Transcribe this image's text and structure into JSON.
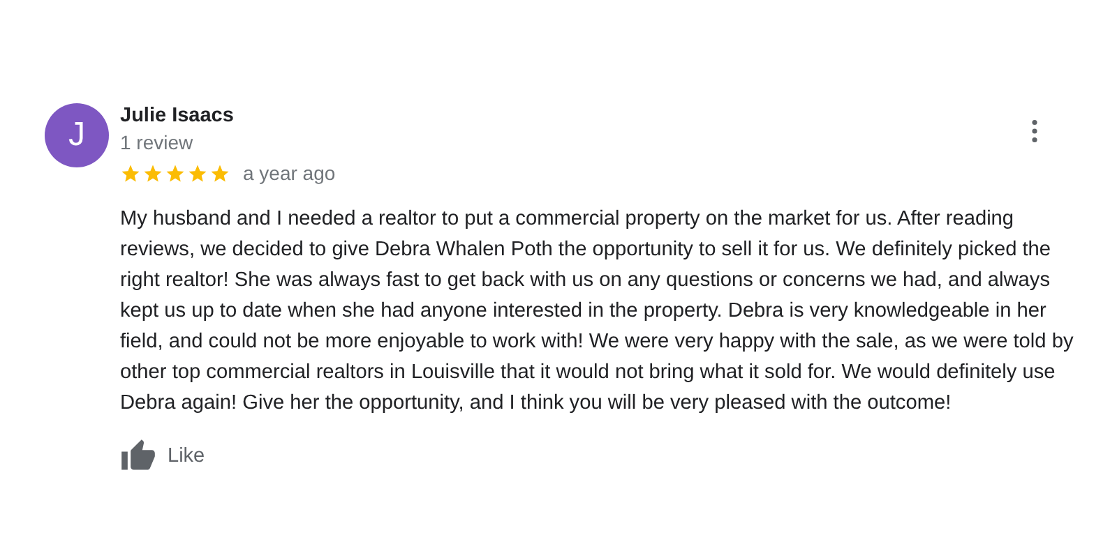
{
  "review": {
    "avatar_letter": "J",
    "name": "Julie Isaacs",
    "review_count": "1 review",
    "stars": 5,
    "time": "a year ago",
    "text": "My husband and I needed a realtor to put a commercial property on the market for us. After reading reviews, we decided to give Debra Whalen Poth the opportunity to sell it for us. We definitely picked the right realtor! She was always fast to get back with us on any questions or concerns we had, and always kept us up to date when she had anyone interested in the property. Debra is very knowledgeable in her field, and could not be more enjoyable to work with! We were very happy with the sale, as we were told by other top commercial realtors in Louisville that it would not bring what it sold for. We would definitely use Debra again! Give her the opportunity, and I think you will be very pleased with the outcome!",
    "like_label": "Like"
  }
}
